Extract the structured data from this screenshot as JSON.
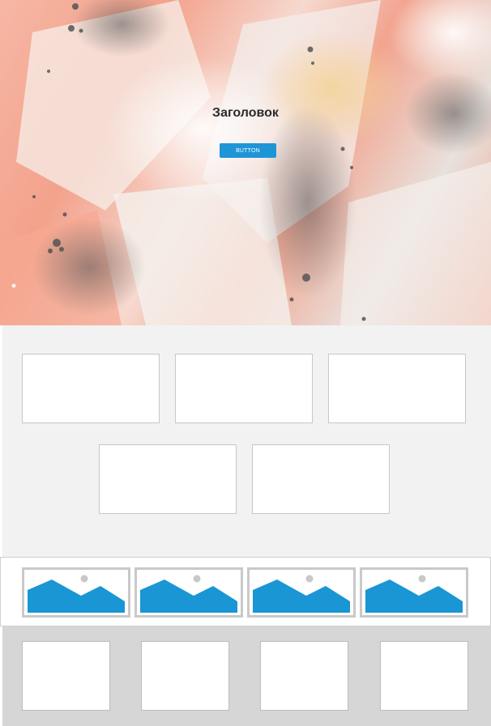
{
  "hero": {
    "title": "Заголовок",
    "button_label": "BUTTON",
    "button_color": "#1d95d6",
    "background_image": "abstract-spray-paint-image"
  },
  "cards_section": {
    "background": "#f2f2f2",
    "cards": [
      {
        "id": "card-1"
      },
      {
        "id": "card-2"
      },
      {
        "id": "card-3"
      },
      {
        "id": "card-4"
      },
      {
        "id": "card-5"
      }
    ]
  },
  "gallery": {
    "items": [
      {
        "icon": "image-placeholder-icon"
      },
      {
        "icon": "image-placeholder-icon"
      },
      {
        "icon": "image-placeholder-icon"
      },
      {
        "icon": "image-placeholder-icon"
      }
    ],
    "icon_color": "#1a96d4"
  },
  "bottom_boxes": {
    "background": "#d6d6d6",
    "boxes": [
      {
        "id": "box-1"
      },
      {
        "id": "box-2"
      },
      {
        "id": "box-3"
      },
      {
        "id": "box-4"
      }
    ]
  }
}
